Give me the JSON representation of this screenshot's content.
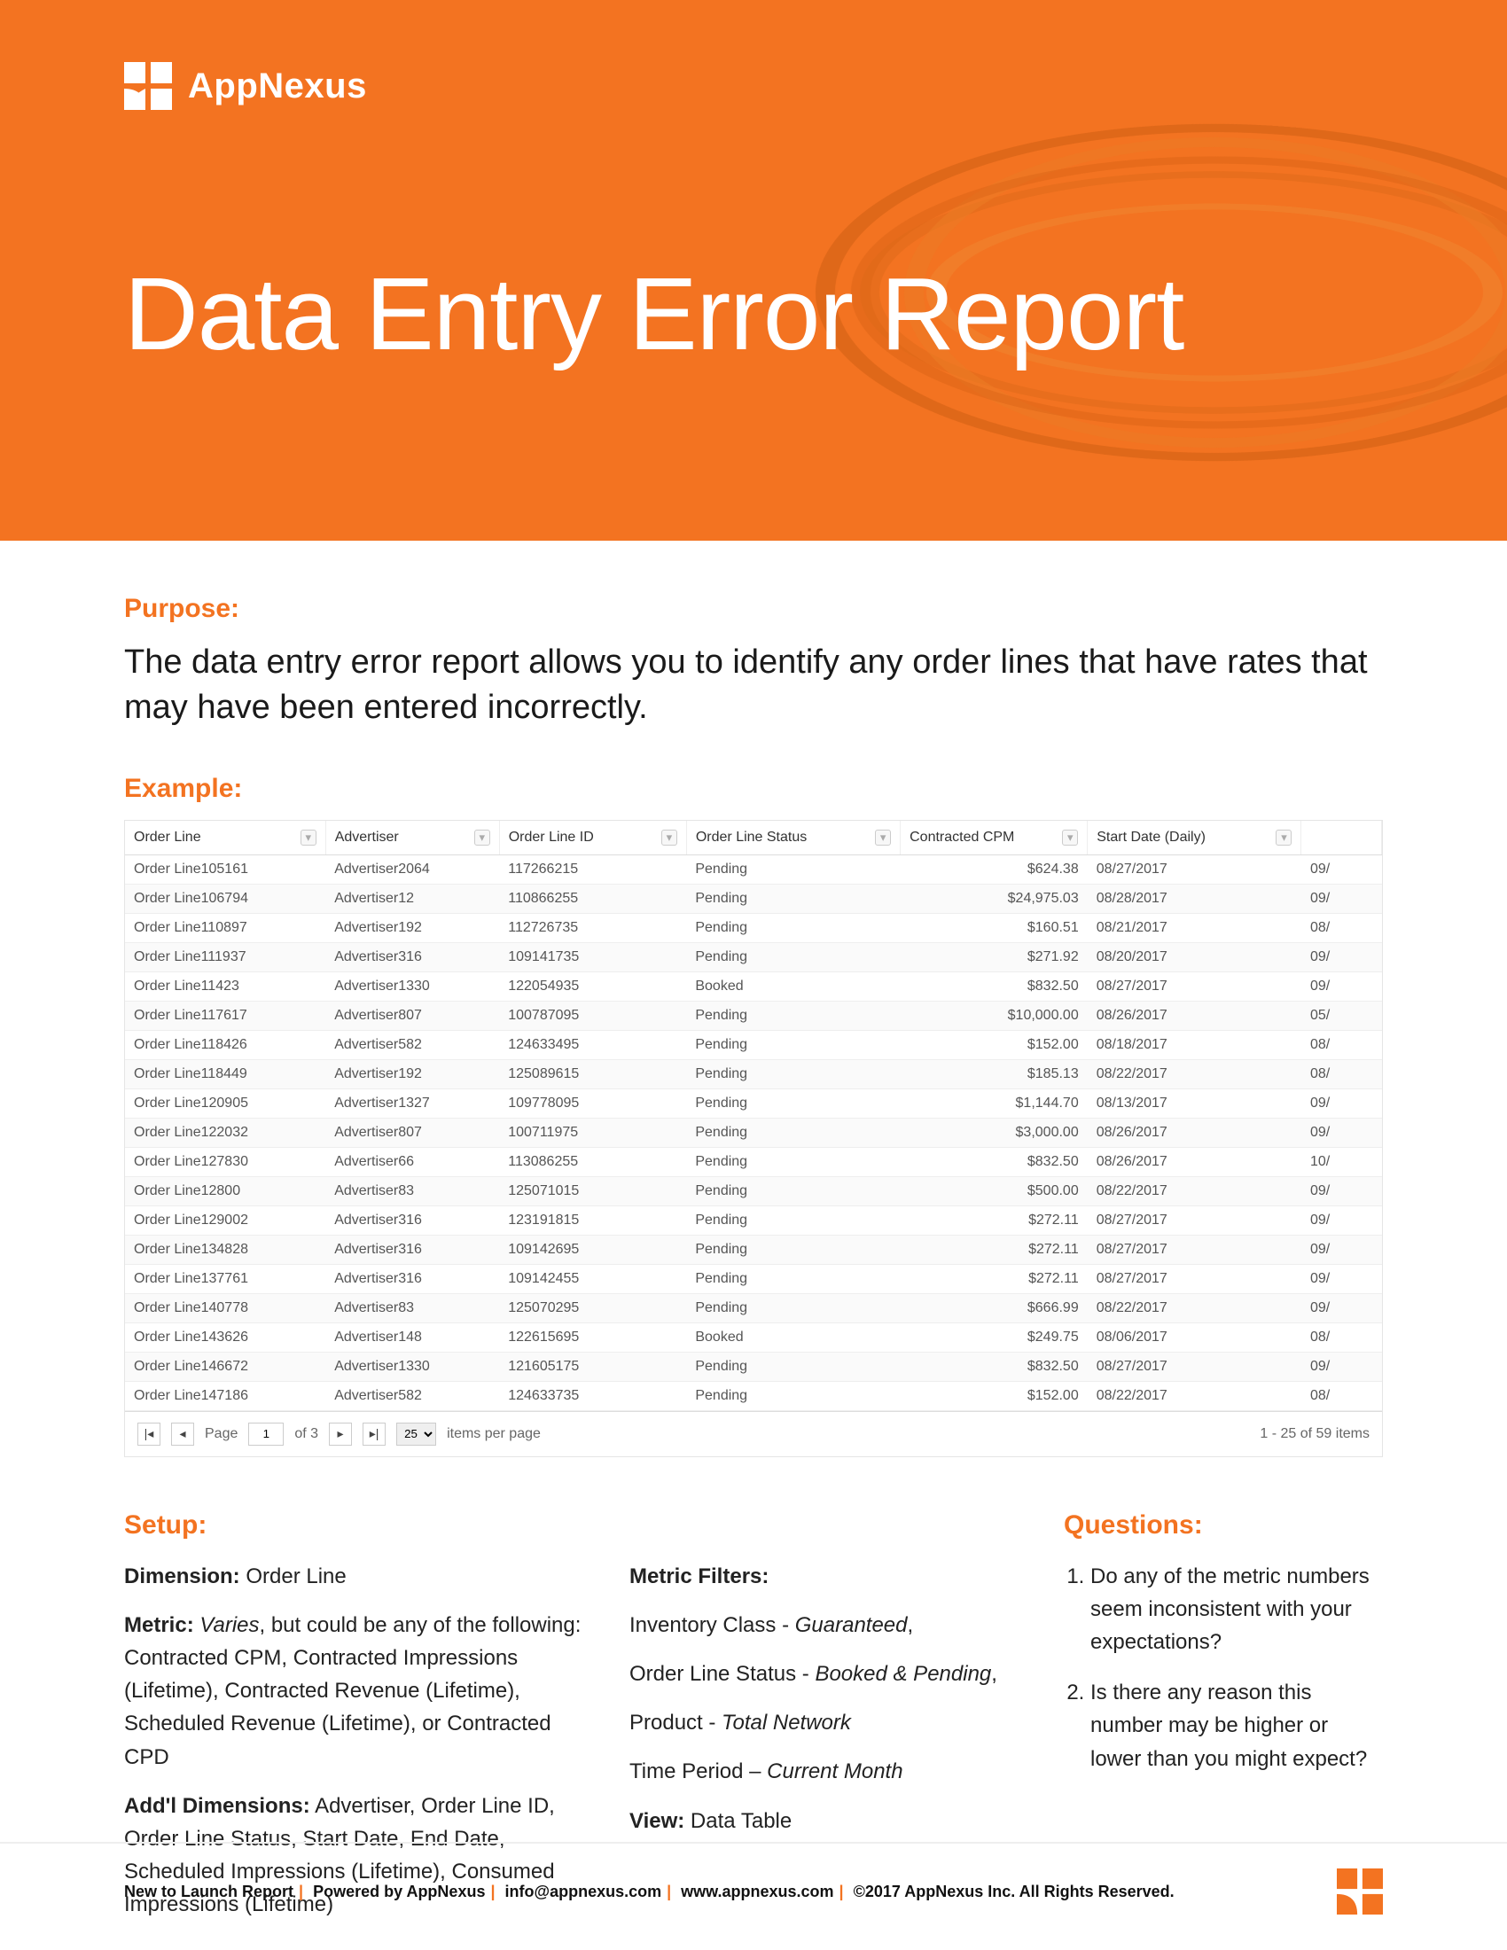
{
  "brand": {
    "name": "AppNexus"
  },
  "hero": {
    "title": "Data Entry Error Report"
  },
  "purpose": {
    "label": "Purpose:",
    "text": "The data entry error report allows you to identify any order lines that have rates that may have been entered incorrectly."
  },
  "example": {
    "label": "Example:",
    "columns": {
      "order_line": "Order Line",
      "advertiser": "Advertiser",
      "order_line_id": "Order Line ID",
      "order_line_status": "Order Line Status",
      "contracted_cpm": "Contracted CPM",
      "start_date": "Start Date  (Daily)"
    },
    "rows": [
      {
        "order_line": "Order Line105161",
        "advertiser": "Advertiser2064",
        "id": "117266215",
        "status": "Pending",
        "cpm": "$624.38",
        "date": "08/27/2017",
        "extra": "09/"
      },
      {
        "order_line": "Order Line106794",
        "advertiser": "Advertiser12",
        "id": "110866255",
        "status": "Pending",
        "cpm": "$24,975.03",
        "date": "08/28/2017",
        "extra": "09/"
      },
      {
        "order_line": "Order Line110897",
        "advertiser": "Advertiser192",
        "id": "112726735",
        "status": "Pending",
        "cpm": "$160.51",
        "date": "08/21/2017",
        "extra": "08/"
      },
      {
        "order_line": "Order Line111937",
        "advertiser": "Advertiser316",
        "id": "109141735",
        "status": "Pending",
        "cpm": "$271.92",
        "date": "08/20/2017",
        "extra": "09/"
      },
      {
        "order_line": "Order Line11423",
        "advertiser": "Advertiser1330",
        "id": "122054935",
        "status": "Booked",
        "cpm": "$832.50",
        "date": "08/27/2017",
        "extra": "09/"
      },
      {
        "order_line": "Order Line117617",
        "advertiser": "Advertiser807",
        "id": "100787095",
        "status": "Pending",
        "cpm": "$10,000.00",
        "date": "08/26/2017",
        "extra": "05/"
      },
      {
        "order_line": "Order Line118426",
        "advertiser": "Advertiser582",
        "id": "124633495",
        "status": "Pending",
        "cpm": "$152.00",
        "date": "08/18/2017",
        "extra": "08/"
      },
      {
        "order_line": "Order Line118449",
        "advertiser": "Advertiser192",
        "id": "125089615",
        "status": "Pending",
        "cpm": "$185.13",
        "date": "08/22/2017",
        "extra": "08/"
      },
      {
        "order_line": "Order Line120905",
        "advertiser": "Advertiser1327",
        "id": "109778095",
        "status": "Pending",
        "cpm": "$1,144.70",
        "date": "08/13/2017",
        "extra": "09/"
      },
      {
        "order_line": "Order Line122032",
        "advertiser": "Advertiser807",
        "id": "100711975",
        "status": "Pending",
        "cpm": "$3,000.00",
        "date": "08/26/2017",
        "extra": "09/"
      },
      {
        "order_line": "Order Line127830",
        "advertiser": "Advertiser66",
        "id": "113086255",
        "status": "Pending",
        "cpm": "$832.50",
        "date": "08/26/2017",
        "extra": "10/"
      },
      {
        "order_line": "Order Line12800",
        "advertiser": "Advertiser83",
        "id": "125071015",
        "status": "Pending",
        "cpm": "$500.00",
        "date": "08/22/2017",
        "extra": "09/"
      },
      {
        "order_line": "Order Line129002",
        "advertiser": "Advertiser316",
        "id": "123191815",
        "status": "Pending",
        "cpm": "$272.11",
        "date": "08/27/2017",
        "extra": "09/"
      },
      {
        "order_line": "Order Line134828",
        "advertiser": "Advertiser316",
        "id": "109142695",
        "status": "Pending",
        "cpm": "$272.11",
        "date": "08/27/2017",
        "extra": "09/"
      },
      {
        "order_line": "Order Line137761",
        "advertiser": "Advertiser316",
        "id": "109142455",
        "status": "Pending",
        "cpm": "$272.11",
        "date": "08/27/2017",
        "extra": "09/"
      },
      {
        "order_line": "Order Line140778",
        "advertiser": "Advertiser83",
        "id": "125070295",
        "status": "Pending",
        "cpm": "$666.99",
        "date": "08/22/2017",
        "extra": "09/"
      },
      {
        "order_line": "Order Line143626",
        "advertiser": "Advertiser148",
        "id": "122615695",
        "status": "Booked",
        "cpm": "$249.75",
        "date": "08/06/2017",
        "extra": "08/"
      },
      {
        "order_line": "Order Line146672",
        "advertiser": "Advertiser1330",
        "id": "121605175",
        "status": "Pending",
        "cpm": "$832.50",
        "date": "08/27/2017",
        "extra": "09/"
      },
      {
        "order_line": "Order Line147186",
        "advertiser": "Advertiser582",
        "id": "124633735",
        "status": "Pending",
        "cpm": "$152.00",
        "date": "08/22/2017",
        "extra": "08/"
      }
    ],
    "pager": {
      "page_label": "Page",
      "page_value": "1",
      "of_label": "of 3",
      "page_size": "25",
      "items_per_page": "items per page",
      "summary": "1 - 25 of 59 items"
    }
  },
  "setup": {
    "label": "Setup:",
    "dimension_label": "Dimension:",
    "dimension_value": "Order Line",
    "metric_label": "Metric:",
    "metric_italic": "Varies",
    "metric_rest": ", but could be any of the following: Contracted CPM, Contracted Impressions (Lifetime), Contracted Revenue (Lifetime), Scheduled Revenue (Lifetime), or Contracted CPD",
    "addl_label": "Add'l Dimensions:",
    "addl_value": "Advertiser, Order Line ID, Order Line Status, Start Date, End Date, Scheduled Impressions (Lifetime), Consumed Impressions (Lifetime)",
    "filters_label": "Metric Filters:",
    "filter_inventory": "Inventory Class - ",
    "filter_inventory_i": "Guaranteed",
    "filter_status": "Order Line Status - ",
    "filter_status_i": "Booked & Pending",
    "filter_product": "Product - ",
    "filter_product_i": "Total Network",
    "filter_time": "Time Period – ",
    "filter_time_i": "Current Month",
    "view_label": "View:",
    "view_value": "Data Table"
  },
  "questions": {
    "label": "Questions:",
    "q1": "Do any of the metric numbers seem inconsistent with your expectations?",
    "q2": "Is there any reason this number may be higher or lower than you might expect?"
  },
  "footer": {
    "p1": "New to Launch Report",
    "p2": "Powered by AppNexus",
    "p3": "info@appnexus.com",
    "p4": "www.appnexus.com",
    "p5": "©2017 AppNexus Inc. All Rights Reserved."
  }
}
